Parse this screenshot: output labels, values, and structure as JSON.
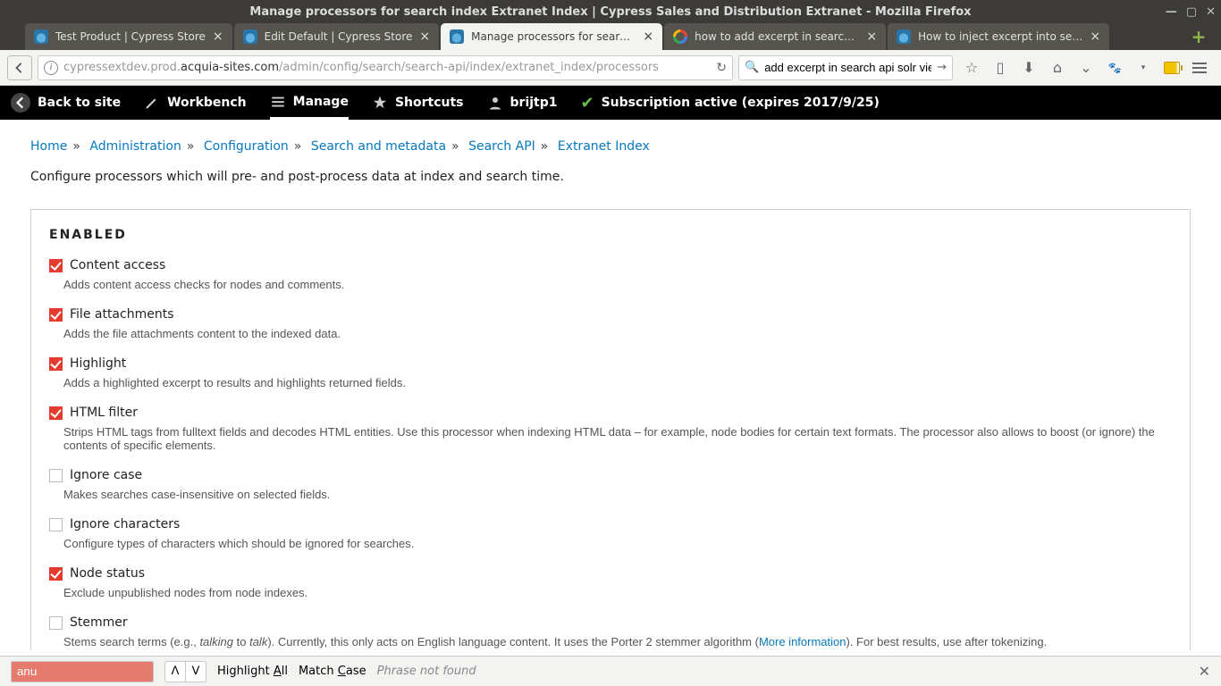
{
  "window": {
    "title": "Manage processors for search index Extranet Index | Cypress Sales and Distribution Extranet - Mozilla Firefox"
  },
  "tabs": [
    {
      "label": "Test Product | Cypress Store",
      "favicon": "drupal",
      "active": false
    },
    {
      "label": "Edit Default | Cypress Store",
      "favicon": "drupal",
      "active": false
    },
    {
      "label": "Manage processors for search i...",
      "favicon": "drupal",
      "active": true
    },
    {
      "label": "how to add excerpt in search ap...",
      "favicon": "google",
      "active": false
    },
    {
      "label": "How to inject excerpt into searc...",
      "favicon": "drupal",
      "active": false
    }
  ],
  "url": {
    "prefix": "cypressextdev.prod.",
    "host": "acquia-sites.com",
    "path": "/admin/config/search/search-api/index/extranet_index/processors"
  },
  "search": {
    "value": "add excerpt in search api solr views"
  },
  "admin": {
    "back": "Back to site",
    "workbench": "Workbench",
    "manage": "Manage",
    "shortcuts": "Shortcuts",
    "user": "brijtp1",
    "subscription": "Subscription active (expires 2017/9/25)"
  },
  "breadcrumb": {
    "home": "Home",
    "administration": "Administration",
    "configuration": "Configuration",
    "search_meta": "Search and metadata",
    "search_api": "Search API",
    "extranet": "Extranet Index"
  },
  "intro": "Configure processors which will pre- and post-process data at index and search time.",
  "panel_title": "ENABLED",
  "processors": [
    {
      "label": "Content access",
      "checked": true,
      "desc": "Adds content access checks for nodes and comments."
    },
    {
      "label": "File attachments",
      "checked": true,
      "desc": "Adds the file attachments content to the indexed data."
    },
    {
      "label": "Highlight",
      "checked": true,
      "desc": "Adds a highlighted excerpt to results and highlights returned fields."
    },
    {
      "label": "HTML filter",
      "checked": true,
      "desc": "Strips HTML tags from fulltext fields and decodes HTML entities. Use this processor when indexing HTML data – for example, node bodies for certain text formats. The processor also allows to boost (or ignore) the contents of specific elements."
    },
    {
      "label": "Ignore case",
      "checked": false,
      "desc": "Makes searches case-insensitive on selected fields."
    },
    {
      "label": "Ignore characters",
      "checked": false,
      "desc": "Configure types of characters which should be ignored for searches."
    },
    {
      "label": "Node status",
      "checked": true,
      "desc": "Exclude unpublished nodes from node indexes."
    },
    {
      "label": "Stemmer",
      "checked": false,
      "desc_pre": "Stems search terms (e.g., ",
      "desc_em1": "talking",
      "desc_mid": " to ",
      "desc_em2": "talk",
      "desc_post": "). Currently, this only acts on English language content. It uses the Porter 2 stemmer algorithm (",
      "link": "More information",
      "desc_end": "). For best results, use after tokenizing."
    }
  ],
  "findbar": {
    "value": "anu",
    "highlight": "Highlight All",
    "matchcase": "Match Case",
    "notfound": "Phrase not found"
  }
}
